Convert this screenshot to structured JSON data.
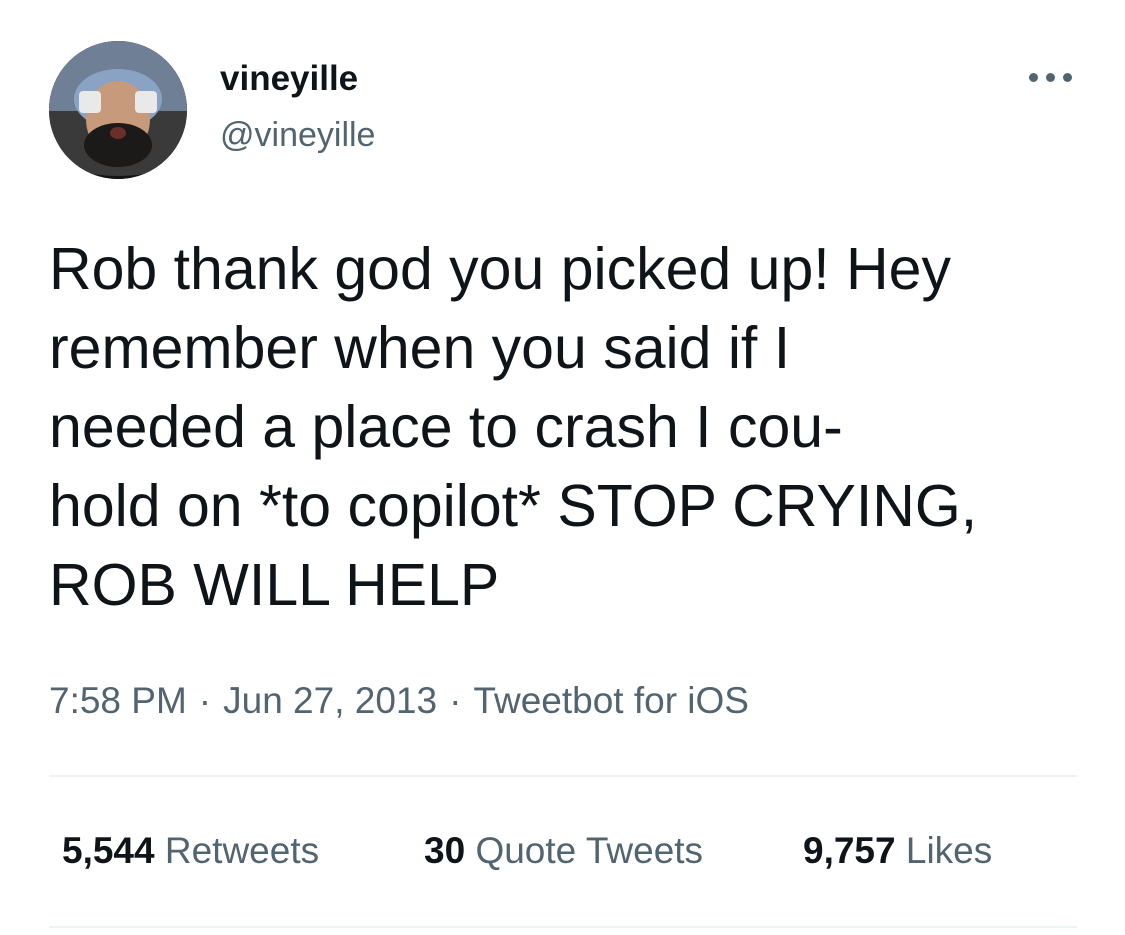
{
  "user": {
    "display_name": "vineyille",
    "handle": "@vineyille",
    "avatar_icon": "profile-photo"
  },
  "tweet": {
    "lines": [
      "Rob thank god you picked up! Hey",
      "remember when you said if I",
      "needed a place to crash I cou-",
      "hold on *to copilot* STOP CRYING,",
      "ROB WILL HELP"
    ],
    "time": "7:58 PM",
    "date": "Jun 27, 2013",
    "separator": "·",
    "source": "Tweetbot for iOS"
  },
  "stats": {
    "retweets": {
      "count": "5,544",
      "label": "Retweets"
    },
    "quotes": {
      "count": "30",
      "label": "Quote Tweets"
    },
    "likes": {
      "count": "9,757",
      "label": "Likes"
    }
  },
  "icons": {
    "more": "more-horizontal-icon"
  },
  "colors": {
    "text": "#0f1419",
    "secondary": "#536471",
    "divider": "#eff3f4"
  }
}
